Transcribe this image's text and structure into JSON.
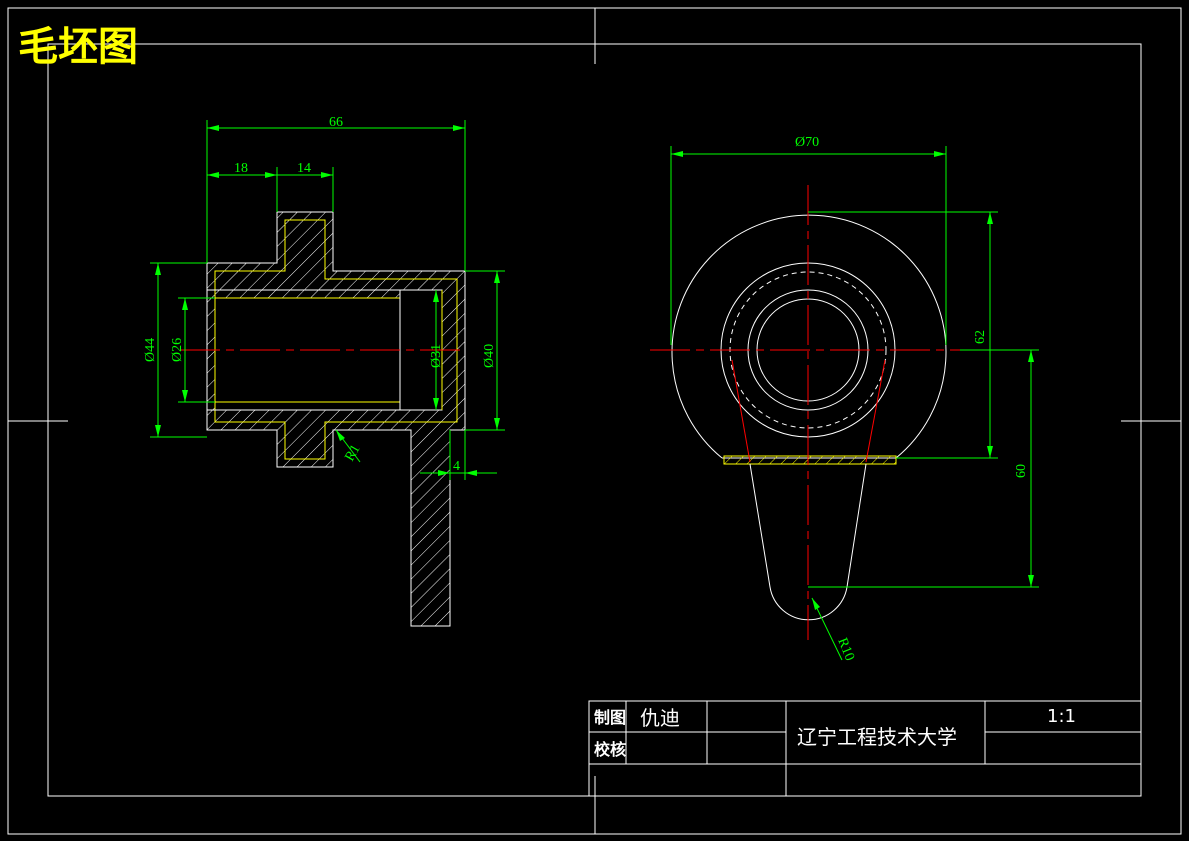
{
  "drawing": {
    "title": "毛坯图",
    "colors": {
      "background": "#000000",
      "outline": "#ffffff",
      "dimension": "#00ff00",
      "centerline": "#ff0000",
      "title": "#ffff00"
    },
    "left_view_dims": {
      "overall_length": "66",
      "step1": "18",
      "step2": "14",
      "outer_dia": "Ø44",
      "bore_dia": "Ø26",
      "counterbore_dia": "Ø31",
      "flange_dia": "Ø40",
      "fillet_radius": "R1",
      "lug_thickness": "4"
    },
    "right_view_dims": {
      "outer_dia": "Ø70",
      "height_upper": "62",
      "height_lower": "60",
      "end_radius": "R10"
    }
  },
  "title_block": {
    "draw_label": "制图",
    "drafter_name": "仇迪",
    "check_label": "校核",
    "organization": "辽宁工程技术大学",
    "scale": "1:1"
  }
}
